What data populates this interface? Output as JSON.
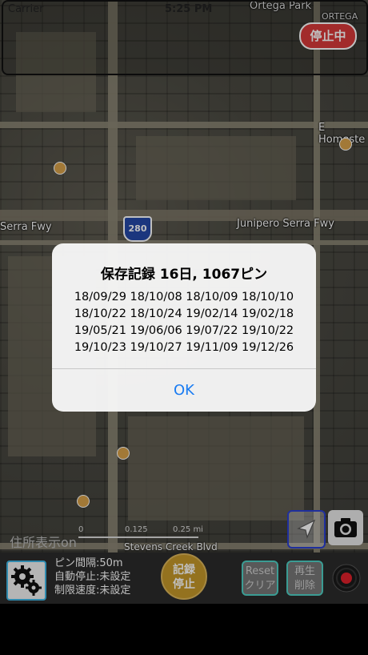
{
  "status_bar": {
    "carrier": "Carrier",
    "time": "5:25 PM"
  },
  "map": {
    "labels": {
      "ortega_park": "Ortega Park",
      "ortega": "ORTEGA",
      "e_homestead": "E Homeste",
      "serra_fwy_left": "Serra Fwy",
      "junipero_serra_fwy": "Junipero Serra Fwy",
      "stevens_creek_blvd": "Stevens Creek Blvd"
    },
    "interstate_shield": "280",
    "scale_labels": [
      "0",
      "0.125",
      "0.25 mi"
    ]
  },
  "badge": {
    "stop_label": "停止中"
  },
  "alert": {
    "title": "保存記録 16日, 1067ピン",
    "lines": [
      "18/09/29 18/10/08 18/10/09 18/10/10",
      "18/10/22 18/10/24 19/02/14 19/02/18",
      "19/05/21 19/06/06 19/07/22 19/10/22",
      "19/10/23 19/10/27 19/11/09 19/12/26"
    ],
    "ok_label": "OK"
  },
  "map_controls": {
    "address_label": "住所表示on"
  },
  "toolbar": {
    "settings_lines": [
      "ピン間隔:50m",
      "自動停止:未設定",
      "制限速度:未設定"
    ],
    "record_label_line1": "記録",
    "record_label_line2": "停止",
    "reset_line1": "Reset",
    "reset_line2": "クリア",
    "replay_line1": "再生",
    "replay_line2": "削除"
  },
  "colors": {
    "accent_blue": "#1a7cf2",
    "stop_red": "#d93a3a",
    "record_gold": "#c6992a",
    "button_teal": "#4fd1c5"
  },
  "icons": {
    "settings": "gear-icon",
    "locate": "location-arrow-icon",
    "camera": "camera-icon",
    "record": "record-dot-icon"
  }
}
